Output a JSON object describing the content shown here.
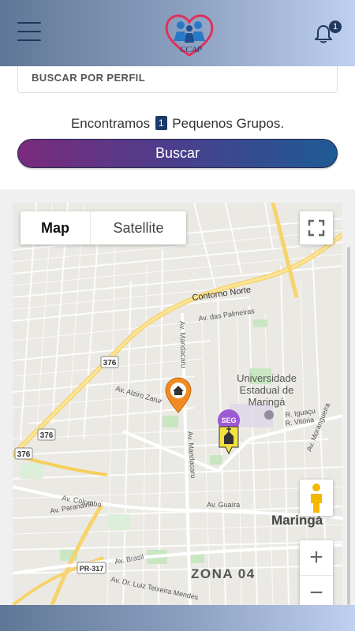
{
  "header": {
    "logo_text": "CCAP",
    "notification_count": "1"
  },
  "search": {
    "perfil_label": "BUSCAR POR PERFIL",
    "found_prefix": "Encontramos",
    "found_count": "1",
    "found_suffix": "Pequenos Grupos.",
    "button_label": "Buscar"
  },
  "map": {
    "type_map": "Map",
    "type_satellite": "Satellite",
    "labels": {
      "contorno_norte": "Contorno Norte",
      "av_palmeiras": "Av. das Palmeiras",
      "av_mandacaru_1": "Av. Mandacaru",
      "av_mandacaru_2": "Av. Mandacaru",
      "av_alziro": "Av. Alziro Zarur",
      "uni_line1": "Universidade",
      "uni_line2": "Estadual de",
      "uni_line3": "Maringá",
      "r_iguacu": "R. Iguaçu",
      "r_vitoria": "R. Vitória",
      "av_morangueira": "Av. Morangueira",
      "av_colombo": "Av. Colombo",
      "av_paranavai": "Av. Paranavaí",
      "av_guaira": "Av. Guaíra",
      "maringa": "Maringá",
      "av_brasil": "Av. Brasil",
      "av_luiz": "Av. Dr. Luiz Teixeira Mendes",
      "zona": "ZONA 04",
      "road_376a": "376",
      "road_376b": "376",
      "road_376c": "376",
      "road_pr317": "PR-317",
      "seg": "SEG"
    },
    "zoom_in": "+",
    "zoom_out": "−"
  }
}
